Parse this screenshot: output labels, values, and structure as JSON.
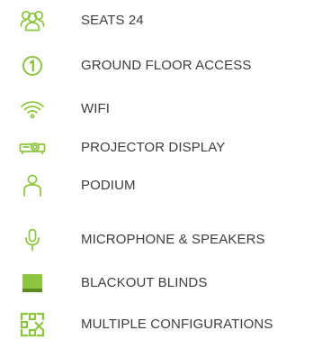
{
  "accent_color": "#8cc63f",
  "text_color": "#3e3e3e",
  "features": [
    {
      "icon": "people-icon",
      "label": "SEATS 24"
    },
    {
      "icon": "number-one-circle-icon",
      "label": "GROUND FLOOR ACCESS"
    },
    {
      "icon": "wifi-icon",
      "label": "WIFI"
    },
    {
      "icon": "projector-icon",
      "label": "PROJECTOR DISPLAY"
    },
    {
      "icon": "podium-icon",
      "label": "PODIUM"
    },
    {
      "icon": "microphone-icon",
      "label": "MICROPHONE & SPEAKERS"
    },
    {
      "icon": "blackout-blinds-icon",
      "label": "BLACKOUT BLINDS"
    },
    {
      "icon": "multiple-configurations-icon",
      "label": "MULTIPLE CONFIGURATIONS"
    }
  ]
}
